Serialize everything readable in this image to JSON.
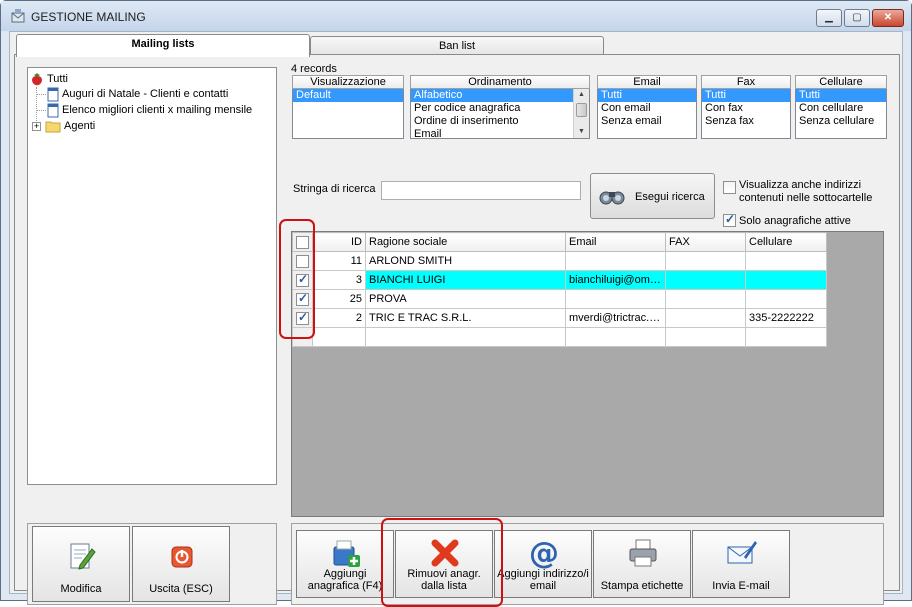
{
  "window": {
    "title": "GESTIONE MAILING"
  },
  "tabs": [
    {
      "label": "Mailing lists"
    },
    {
      "label": "Ban list"
    }
  ],
  "tree": {
    "root": "Tutti",
    "children": [
      "Auguri di Natale - Clienti e contatti",
      "Elenco migliori clienti x mailing mensile"
    ],
    "folder": "Agenti"
  },
  "records_count": "4 records",
  "filters": {
    "visualizzazione": {
      "header": "Visualizzazione",
      "options": [
        "Default"
      ]
    },
    "ordinamento": {
      "header": "Ordinamento",
      "options": [
        "Alfabetico",
        "Per codice anagrafica",
        "Ordine di inserimento",
        "Email"
      ]
    },
    "email": {
      "header": "Email",
      "options": [
        "Tutti",
        "Con email",
        "Senza email"
      ]
    },
    "fax": {
      "header": "Fax",
      "options": [
        "Tutti",
        "Con fax",
        "Senza fax"
      ]
    },
    "cellulare": {
      "header": "Cellulare",
      "options": [
        "Tutti",
        "Con cellulare",
        "Senza cellulare"
      ]
    }
  },
  "search": {
    "label": "Stringa di ricerca",
    "value": "",
    "button": "Esegui ricerca"
  },
  "options": {
    "subfolders_line1": "Visualizza anche indirizzi",
    "subfolders_line2": "contenuti nelle sottocartelle",
    "subfolders_checked": false,
    "active_only": "Solo anagrafiche attive",
    "active_only_checked": true
  },
  "grid": {
    "columns": [
      "ID",
      "Ragione sociale",
      "Email",
      "FAX",
      "Cellulare"
    ],
    "rows": [
      {
        "checked": false,
        "id": "11",
        "name": "ARLOND SMITH",
        "email": "",
        "fax": "",
        "cell": ""
      },
      {
        "checked": true,
        "id": "3",
        "name": "BIANCHI LUIGI",
        "email": "bianchiluigi@omni...",
        "fax": "",
        "cell": ""
      },
      {
        "checked": true,
        "id": "25",
        "name": "PROVA",
        "email": "",
        "fax": "",
        "cell": ""
      },
      {
        "checked": true,
        "id": "2",
        "name": "TRIC E TRAC S.R.L.",
        "email": "mverdi@trictrac.c...",
        "fax": "",
        "cell": "335-2222222"
      }
    ]
  },
  "toolbar": {
    "add_line1": "Aggiungi",
    "add_line2": "anagrafica (F4)",
    "remove_line1": "Rimuovi anagr.",
    "remove_line2": "dalla lista",
    "add_email_line1": "Aggiungi indirizzo/i",
    "add_email_line2": "email",
    "print": "Stampa etichette",
    "send": "Invia E-mail"
  },
  "left_buttons": {
    "edit": "Modifica",
    "exit": "Uscita (ESC)"
  },
  "colors": {
    "selection": "#3399ff",
    "highlight_row": "#00ffff",
    "annotation": "#d01010"
  }
}
